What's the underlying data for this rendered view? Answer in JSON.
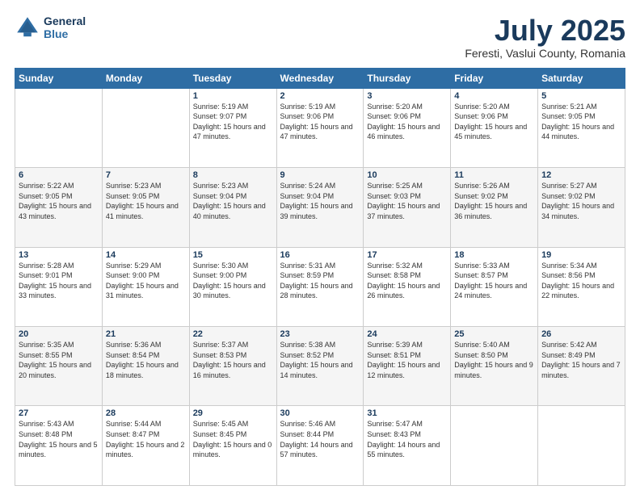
{
  "header": {
    "logo_line1": "General",
    "logo_line2": "Blue",
    "title": "July 2025",
    "subtitle": "Feresti, Vaslui County, Romania"
  },
  "weekdays": [
    "Sunday",
    "Monday",
    "Tuesday",
    "Wednesday",
    "Thursday",
    "Friday",
    "Saturday"
  ],
  "rows": [
    [
      {
        "num": "",
        "sunrise": "",
        "sunset": "",
        "daylight": ""
      },
      {
        "num": "",
        "sunrise": "",
        "sunset": "",
        "daylight": ""
      },
      {
        "num": "1",
        "sunrise": "Sunrise: 5:19 AM",
        "sunset": "Sunset: 9:07 PM",
        "daylight": "Daylight: 15 hours and 47 minutes."
      },
      {
        "num": "2",
        "sunrise": "Sunrise: 5:19 AM",
        "sunset": "Sunset: 9:06 PM",
        "daylight": "Daylight: 15 hours and 47 minutes."
      },
      {
        "num": "3",
        "sunrise": "Sunrise: 5:20 AM",
        "sunset": "Sunset: 9:06 PM",
        "daylight": "Daylight: 15 hours and 46 minutes."
      },
      {
        "num": "4",
        "sunrise": "Sunrise: 5:20 AM",
        "sunset": "Sunset: 9:06 PM",
        "daylight": "Daylight: 15 hours and 45 minutes."
      },
      {
        "num": "5",
        "sunrise": "Sunrise: 5:21 AM",
        "sunset": "Sunset: 9:05 PM",
        "daylight": "Daylight: 15 hours and 44 minutes."
      }
    ],
    [
      {
        "num": "6",
        "sunrise": "Sunrise: 5:22 AM",
        "sunset": "Sunset: 9:05 PM",
        "daylight": "Daylight: 15 hours and 43 minutes."
      },
      {
        "num": "7",
        "sunrise": "Sunrise: 5:23 AM",
        "sunset": "Sunset: 9:05 PM",
        "daylight": "Daylight: 15 hours and 41 minutes."
      },
      {
        "num": "8",
        "sunrise": "Sunrise: 5:23 AM",
        "sunset": "Sunset: 9:04 PM",
        "daylight": "Daylight: 15 hours and 40 minutes."
      },
      {
        "num": "9",
        "sunrise": "Sunrise: 5:24 AM",
        "sunset": "Sunset: 9:04 PM",
        "daylight": "Daylight: 15 hours and 39 minutes."
      },
      {
        "num": "10",
        "sunrise": "Sunrise: 5:25 AM",
        "sunset": "Sunset: 9:03 PM",
        "daylight": "Daylight: 15 hours and 37 minutes."
      },
      {
        "num": "11",
        "sunrise": "Sunrise: 5:26 AM",
        "sunset": "Sunset: 9:02 PM",
        "daylight": "Daylight: 15 hours and 36 minutes."
      },
      {
        "num": "12",
        "sunrise": "Sunrise: 5:27 AM",
        "sunset": "Sunset: 9:02 PM",
        "daylight": "Daylight: 15 hours and 34 minutes."
      }
    ],
    [
      {
        "num": "13",
        "sunrise": "Sunrise: 5:28 AM",
        "sunset": "Sunset: 9:01 PM",
        "daylight": "Daylight: 15 hours and 33 minutes."
      },
      {
        "num": "14",
        "sunrise": "Sunrise: 5:29 AM",
        "sunset": "Sunset: 9:00 PM",
        "daylight": "Daylight: 15 hours and 31 minutes."
      },
      {
        "num": "15",
        "sunrise": "Sunrise: 5:30 AM",
        "sunset": "Sunset: 9:00 PM",
        "daylight": "Daylight: 15 hours and 30 minutes."
      },
      {
        "num": "16",
        "sunrise": "Sunrise: 5:31 AM",
        "sunset": "Sunset: 8:59 PM",
        "daylight": "Daylight: 15 hours and 28 minutes."
      },
      {
        "num": "17",
        "sunrise": "Sunrise: 5:32 AM",
        "sunset": "Sunset: 8:58 PM",
        "daylight": "Daylight: 15 hours and 26 minutes."
      },
      {
        "num": "18",
        "sunrise": "Sunrise: 5:33 AM",
        "sunset": "Sunset: 8:57 PM",
        "daylight": "Daylight: 15 hours and 24 minutes."
      },
      {
        "num": "19",
        "sunrise": "Sunrise: 5:34 AM",
        "sunset": "Sunset: 8:56 PM",
        "daylight": "Daylight: 15 hours and 22 minutes."
      }
    ],
    [
      {
        "num": "20",
        "sunrise": "Sunrise: 5:35 AM",
        "sunset": "Sunset: 8:55 PM",
        "daylight": "Daylight: 15 hours and 20 minutes."
      },
      {
        "num": "21",
        "sunrise": "Sunrise: 5:36 AM",
        "sunset": "Sunset: 8:54 PM",
        "daylight": "Daylight: 15 hours and 18 minutes."
      },
      {
        "num": "22",
        "sunrise": "Sunrise: 5:37 AM",
        "sunset": "Sunset: 8:53 PM",
        "daylight": "Daylight: 15 hours and 16 minutes."
      },
      {
        "num": "23",
        "sunrise": "Sunrise: 5:38 AM",
        "sunset": "Sunset: 8:52 PM",
        "daylight": "Daylight: 15 hours and 14 minutes."
      },
      {
        "num": "24",
        "sunrise": "Sunrise: 5:39 AM",
        "sunset": "Sunset: 8:51 PM",
        "daylight": "Daylight: 15 hours and 12 minutes."
      },
      {
        "num": "25",
        "sunrise": "Sunrise: 5:40 AM",
        "sunset": "Sunset: 8:50 PM",
        "daylight": "Daylight: 15 hours and 9 minutes."
      },
      {
        "num": "26",
        "sunrise": "Sunrise: 5:42 AM",
        "sunset": "Sunset: 8:49 PM",
        "daylight": "Daylight: 15 hours and 7 minutes."
      }
    ],
    [
      {
        "num": "27",
        "sunrise": "Sunrise: 5:43 AM",
        "sunset": "Sunset: 8:48 PM",
        "daylight": "Daylight: 15 hours and 5 minutes."
      },
      {
        "num": "28",
        "sunrise": "Sunrise: 5:44 AM",
        "sunset": "Sunset: 8:47 PM",
        "daylight": "Daylight: 15 hours and 2 minutes."
      },
      {
        "num": "29",
        "sunrise": "Sunrise: 5:45 AM",
        "sunset": "Sunset: 8:45 PM",
        "daylight": "Daylight: 15 hours and 0 minutes."
      },
      {
        "num": "30",
        "sunrise": "Sunrise: 5:46 AM",
        "sunset": "Sunset: 8:44 PM",
        "daylight": "Daylight: 14 hours and 57 minutes."
      },
      {
        "num": "31",
        "sunrise": "Sunrise: 5:47 AM",
        "sunset": "Sunset: 8:43 PM",
        "daylight": "Daylight: 14 hours and 55 minutes."
      },
      {
        "num": "",
        "sunrise": "",
        "sunset": "",
        "daylight": ""
      },
      {
        "num": "",
        "sunrise": "",
        "sunset": "",
        "daylight": ""
      }
    ]
  ]
}
